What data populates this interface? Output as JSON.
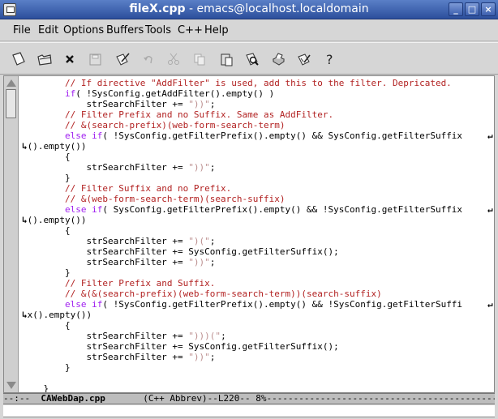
{
  "window": {
    "title_file": "fileX.cpp",
    "title_rest": " - emacs@localhost.localdomain",
    "minimize": "_",
    "maximize": "□",
    "close": "×"
  },
  "menu": [
    "File",
    "Edit",
    "Options",
    "Buffers",
    "Tools",
    "C++",
    "Help"
  ],
  "toolbar_icons": [
    "new-file-icon",
    "open-folder-icon",
    "close-icon",
    "save-disk-icon",
    "edit-icon",
    "undo-icon",
    "cut-icon",
    "copy-icon",
    "paste-icon",
    "search-icon",
    "print-icon",
    "preferences-icon",
    "help-icon"
  ],
  "code_lines": [
    [
      {
        "t": "        ",
        "c": "plain"
      },
      {
        "t": "// If directive \"AddFilter\" is used, add this to the filter. Depricated.",
        "c": "comment"
      }
    ],
    [
      {
        "t": "        ",
        "c": "plain"
      },
      {
        "t": "if",
        "c": "kw"
      },
      {
        "t": "( !SysConfig.getAddFilter().empty() )",
        "c": "plain"
      }
    ],
    [
      {
        "t": "            strSearchFilter += ",
        "c": "plain"
      },
      {
        "t": "\"))\"",
        "c": "str"
      },
      {
        "t": ";",
        "c": "plain"
      }
    ],
    [
      {
        "t": "        ",
        "c": "plain"
      },
      {
        "t": "// Filter Prefix and no Suffix. Same as AddFilter.",
        "c": "comment"
      }
    ],
    [
      {
        "t": "        ",
        "c": "plain"
      },
      {
        "t": "// &(search-prefix)(web-form-search-term)",
        "c": "comment"
      }
    ],
    [
      {
        "t": "        ",
        "c": "plain"
      },
      {
        "t": "else if",
        "c": "kw"
      },
      {
        "t": "( !SysConfig.getFilterPrefix().empty() && SysConfig.getFilterSuffix",
        "c": "plain"
      }
    ],
    [
      {
        "t": "().empty())",
        "c": "plain",
        "cont": true
      }
    ],
    [
      {
        "t": "        {",
        "c": "plain"
      }
    ],
    [
      {
        "t": "            strSearchFilter += ",
        "c": "plain"
      },
      {
        "t": "\"))\"",
        "c": "str"
      },
      {
        "t": ";",
        "c": "plain"
      }
    ],
    [
      {
        "t": "        }",
        "c": "plain"
      }
    ],
    [
      {
        "t": "        ",
        "c": "plain"
      },
      {
        "t": "// Filter Suffix and no Prefix.",
        "c": "comment"
      }
    ],
    [
      {
        "t": "        ",
        "c": "plain"
      },
      {
        "t": "// &(web-form-search-term)(search-suffix)",
        "c": "comment"
      }
    ],
    [
      {
        "t": "        ",
        "c": "plain"
      },
      {
        "t": "else if",
        "c": "kw"
      },
      {
        "t": "( SysConfig.getFilterPrefix().empty() && !SysConfig.getFilterSuffix",
        "c": "plain"
      }
    ],
    [
      {
        "t": "().empty())",
        "c": "plain",
        "cont": true
      }
    ],
    [
      {
        "t": "        {",
        "c": "plain"
      }
    ],
    [
      {
        "t": "            strSearchFilter += ",
        "c": "plain"
      },
      {
        "t": "\")(\"",
        "c": "str"
      },
      {
        "t": ";",
        "c": "plain"
      }
    ],
    [
      {
        "t": "            strSearchFilter += SysConfig.getFilterSuffix();",
        "c": "plain"
      }
    ],
    [
      {
        "t": "            strSearchFilter += ",
        "c": "plain"
      },
      {
        "t": "\"))\"",
        "c": "str"
      },
      {
        "t": ";",
        "c": "plain"
      }
    ],
    [
      {
        "t": "        }",
        "c": "plain"
      }
    ],
    [
      {
        "t": "        ",
        "c": "plain"
      },
      {
        "t": "// Filter Prefix and Suffix.",
        "c": "comment"
      }
    ],
    [
      {
        "t": "        ",
        "c": "plain"
      },
      {
        "t": "// &(&(search-prefix)(web-form-search-term))(search-suffix)",
        "c": "comment"
      }
    ],
    [
      {
        "t": "        ",
        "c": "plain"
      },
      {
        "t": "else if",
        "c": "kw"
      },
      {
        "t": "( !SysConfig.getFilterPrefix().empty() && !SysConfig.getFilterSuffi",
        "c": "plain"
      }
    ],
    [
      {
        "t": "x().empty())",
        "c": "plain",
        "cont": true
      }
    ],
    [
      {
        "t": "        {",
        "c": "plain"
      }
    ],
    [
      {
        "t": "            strSearchFilter += ",
        "c": "plain"
      },
      {
        "t": "\")))(\"",
        "c": "str"
      },
      {
        "t": ";",
        "c": "plain"
      }
    ],
    [
      {
        "t": "            strSearchFilter += SysConfig.getFilterSuffix();",
        "c": "plain"
      }
    ],
    [
      {
        "t": "            strSearchFilter += ",
        "c": "plain"
      },
      {
        "t": "\"))\"",
        "c": "str"
      },
      {
        "t": ";",
        "c": "plain"
      }
    ],
    [
      {
        "t": "        }",
        "c": "plain"
      }
    ],
    [
      {
        "t": "",
        "c": "plain"
      }
    ],
    [
      {
        "t": "    }",
        "c": "plain"
      }
    ]
  ],
  "wrapped_lines": [
    5,
    12,
    21
  ],
  "modeline": {
    "prefix": "--:--  ",
    "buffer": "CAWebDap.cpp",
    "mode": "       (C++ Abbrev)--L220-- 8%",
    "fill": "--------------------------------------------"
  },
  "colors": {
    "comment": "#b22222",
    "keyword": "#a020f0",
    "string": "#bc8f8f"
  }
}
